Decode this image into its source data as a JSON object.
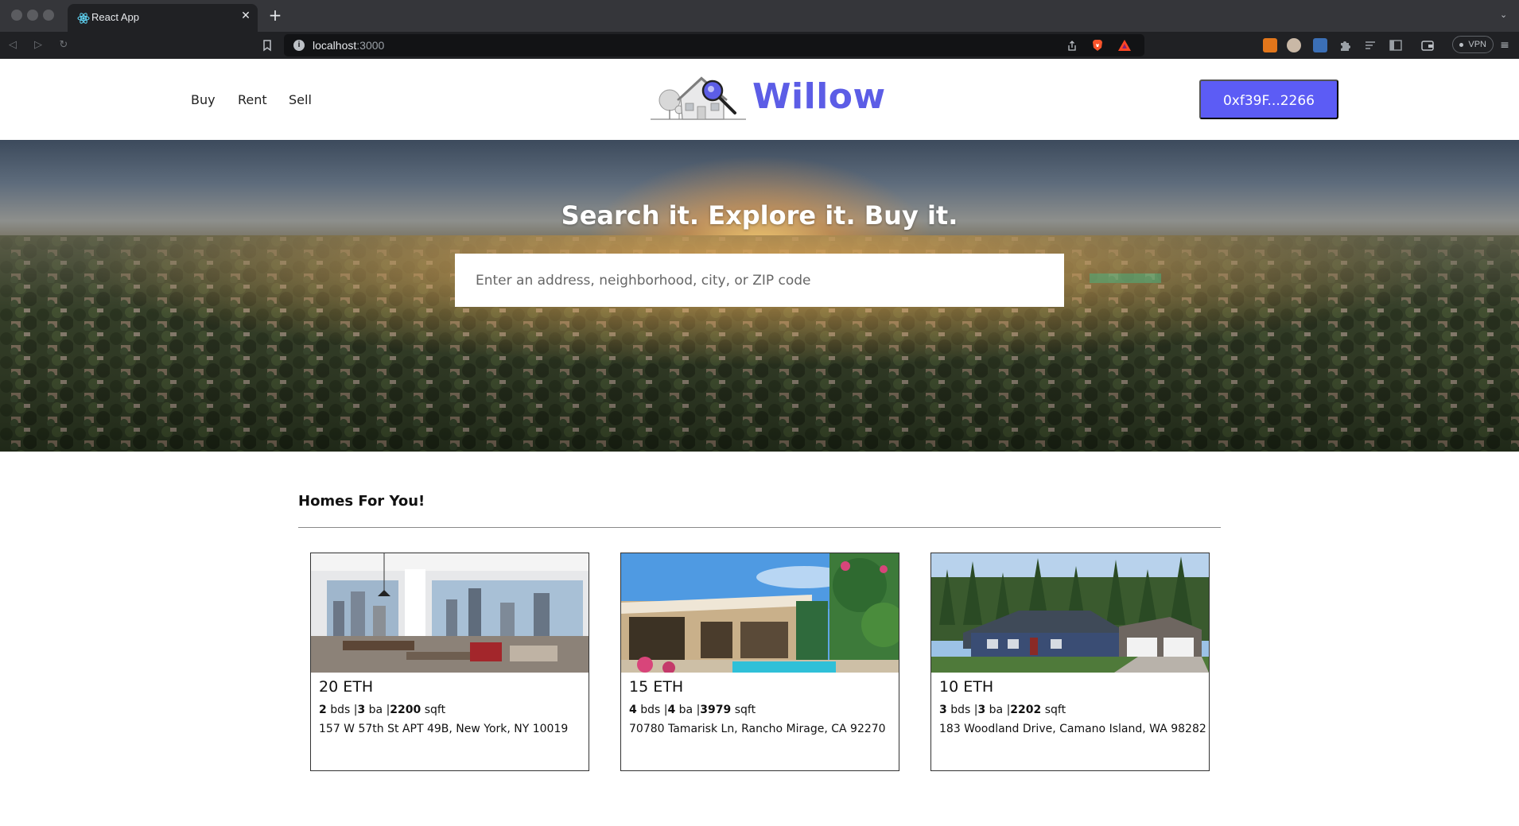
{
  "browser": {
    "tab_title": "React App",
    "url_host": "localhost",
    "url_port": ":3000",
    "vpn_label": "VPN"
  },
  "header": {
    "nav": [
      "Buy",
      "Rent",
      "Sell"
    ],
    "logo_text": "Willow",
    "wallet_label": "0xf39F...2266",
    "accent_color": "#5c5de6"
  },
  "hero": {
    "title": "Search it. Explore it. Buy it.",
    "search_placeholder": "Enter an address, neighborhood, city, or ZIP code"
  },
  "listings": {
    "heading": "Homes For You!",
    "items": [
      {
        "price": "20 ETH",
        "beds": "2",
        "baths": "3",
        "sqft": "2200",
        "beds_unit": "bds",
        "baths_unit": "ba",
        "sqft_unit": "sqft",
        "address": "157 W 57th St APT 49B, New York, NY 10019"
      },
      {
        "price": "15 ETH",
        "beds": "4",
        "baths": "4",
        "sqft": "3979",
        "beds_unit": "bds",
        "baths_unit": "ba",
        "sqft_unit": "sqft",
        "address": "70780 Tamarisk Ln, Rancho Mirage, CA 92270"
      },
      {
        "price": "10 ETH",
        "beds": "3",
        "baths": "3",
        "sqft": "2202",
        "beds_unit": "bds",
        "baths_unit": "ba",
        "sqft_unit": "sqft",
        "address": "183 Woodland Drive, Camano Island, WA 98282"
      }
    ]
  }
}
